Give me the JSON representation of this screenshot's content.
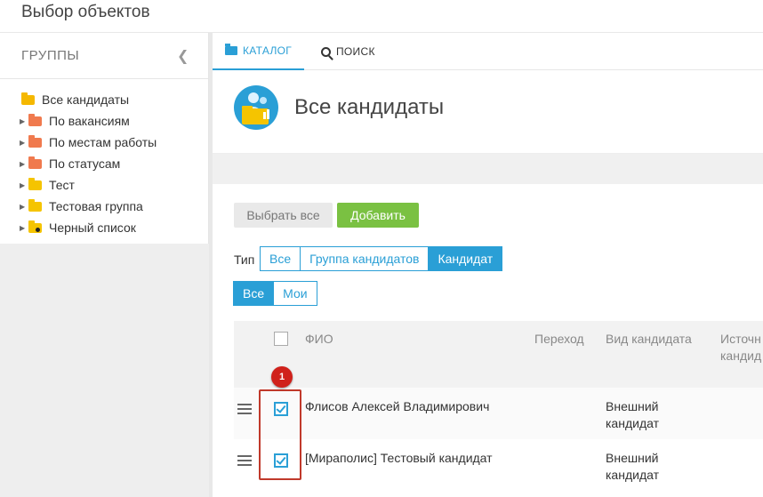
{
  "window": {
    "title": "Выбор объектов"
  },
  "sidebar": {
    "heading": "ГРУППЫ",
    "collapse_icon": "chevron-left-icon",
    "items": [
      {
        "label": "Все кандидаты",
        "folder": "open",
        "expandable": false
      },
      {
        "label": "По вакансиям",
        "folder": "orange",
        "expandable": true
      },
      {
        "label": "По местам работы",
        "folder": "orange",
        "expandable": true
      },
      {
        "label": "По статусам",
        "folder": "orange",
        "expandable": true
      },
      {
        "label": "Тест",
        "folder": "yellow",
        "expandable": true
      },
      {
        "label": "Тестовая группа",
        "folder": "yellow",
        "expandable": true
      },
      {
        "label": "Черный список",
        "folder": "blacklist",
        "expandable": true
      }
    ]
  },
  "tabs": [
    {
      "label": "КАТАЛОГ",
      "icon": "folder-icon",
      "active": true
    },
    {
      "label": "ПОИСК",
      "icon": "search-icon",
      "active": false
    }
  ],
  "header": {
    "title": "Все кандидаты",
    "icon": "candidates-folder-icon"
  },
  "actions": {
    "select_all": "Выбрать все",
    "add": "Добавить"
  },
  "filters": {
    "type_label": "Тип",
    "type_options": [
      "Все",
      "Группа кандидатов",
      "Кандидат"
    ],
    "type_selected": "Кандидат",
    "owner_options": [
      "Все",
      "Мои"
    ],
    "owner_selected": "Все"
  },
  "table": {
    "columns": [
      "ФИО",
      "Переход",
      "Вид кандидата",
      "Источн кандид"
    ],
    "rows": [
      {
        "name": "Флисов Алексей Владимирович",
        "transition": "",
        "kind_line1": "Внешний",
        "kind_line2": "кандидат",
        "checked": true
      },
      {
        "name": "[Мираполис] Тестовый кандидат",
        "transition": "",
        "kind_line1": "Внешний",
        "kind_line2": "кандидат",
        "checked": true
      }
    ]
  },
  "annotation": {
    "badge": "1"
  },
  "colors": {
    "accent": "#2a9fd6",
    "add_button": "#7ac142",
    "highlight": "#c0392b",
    "badge": "#d0211b"
  }
}
